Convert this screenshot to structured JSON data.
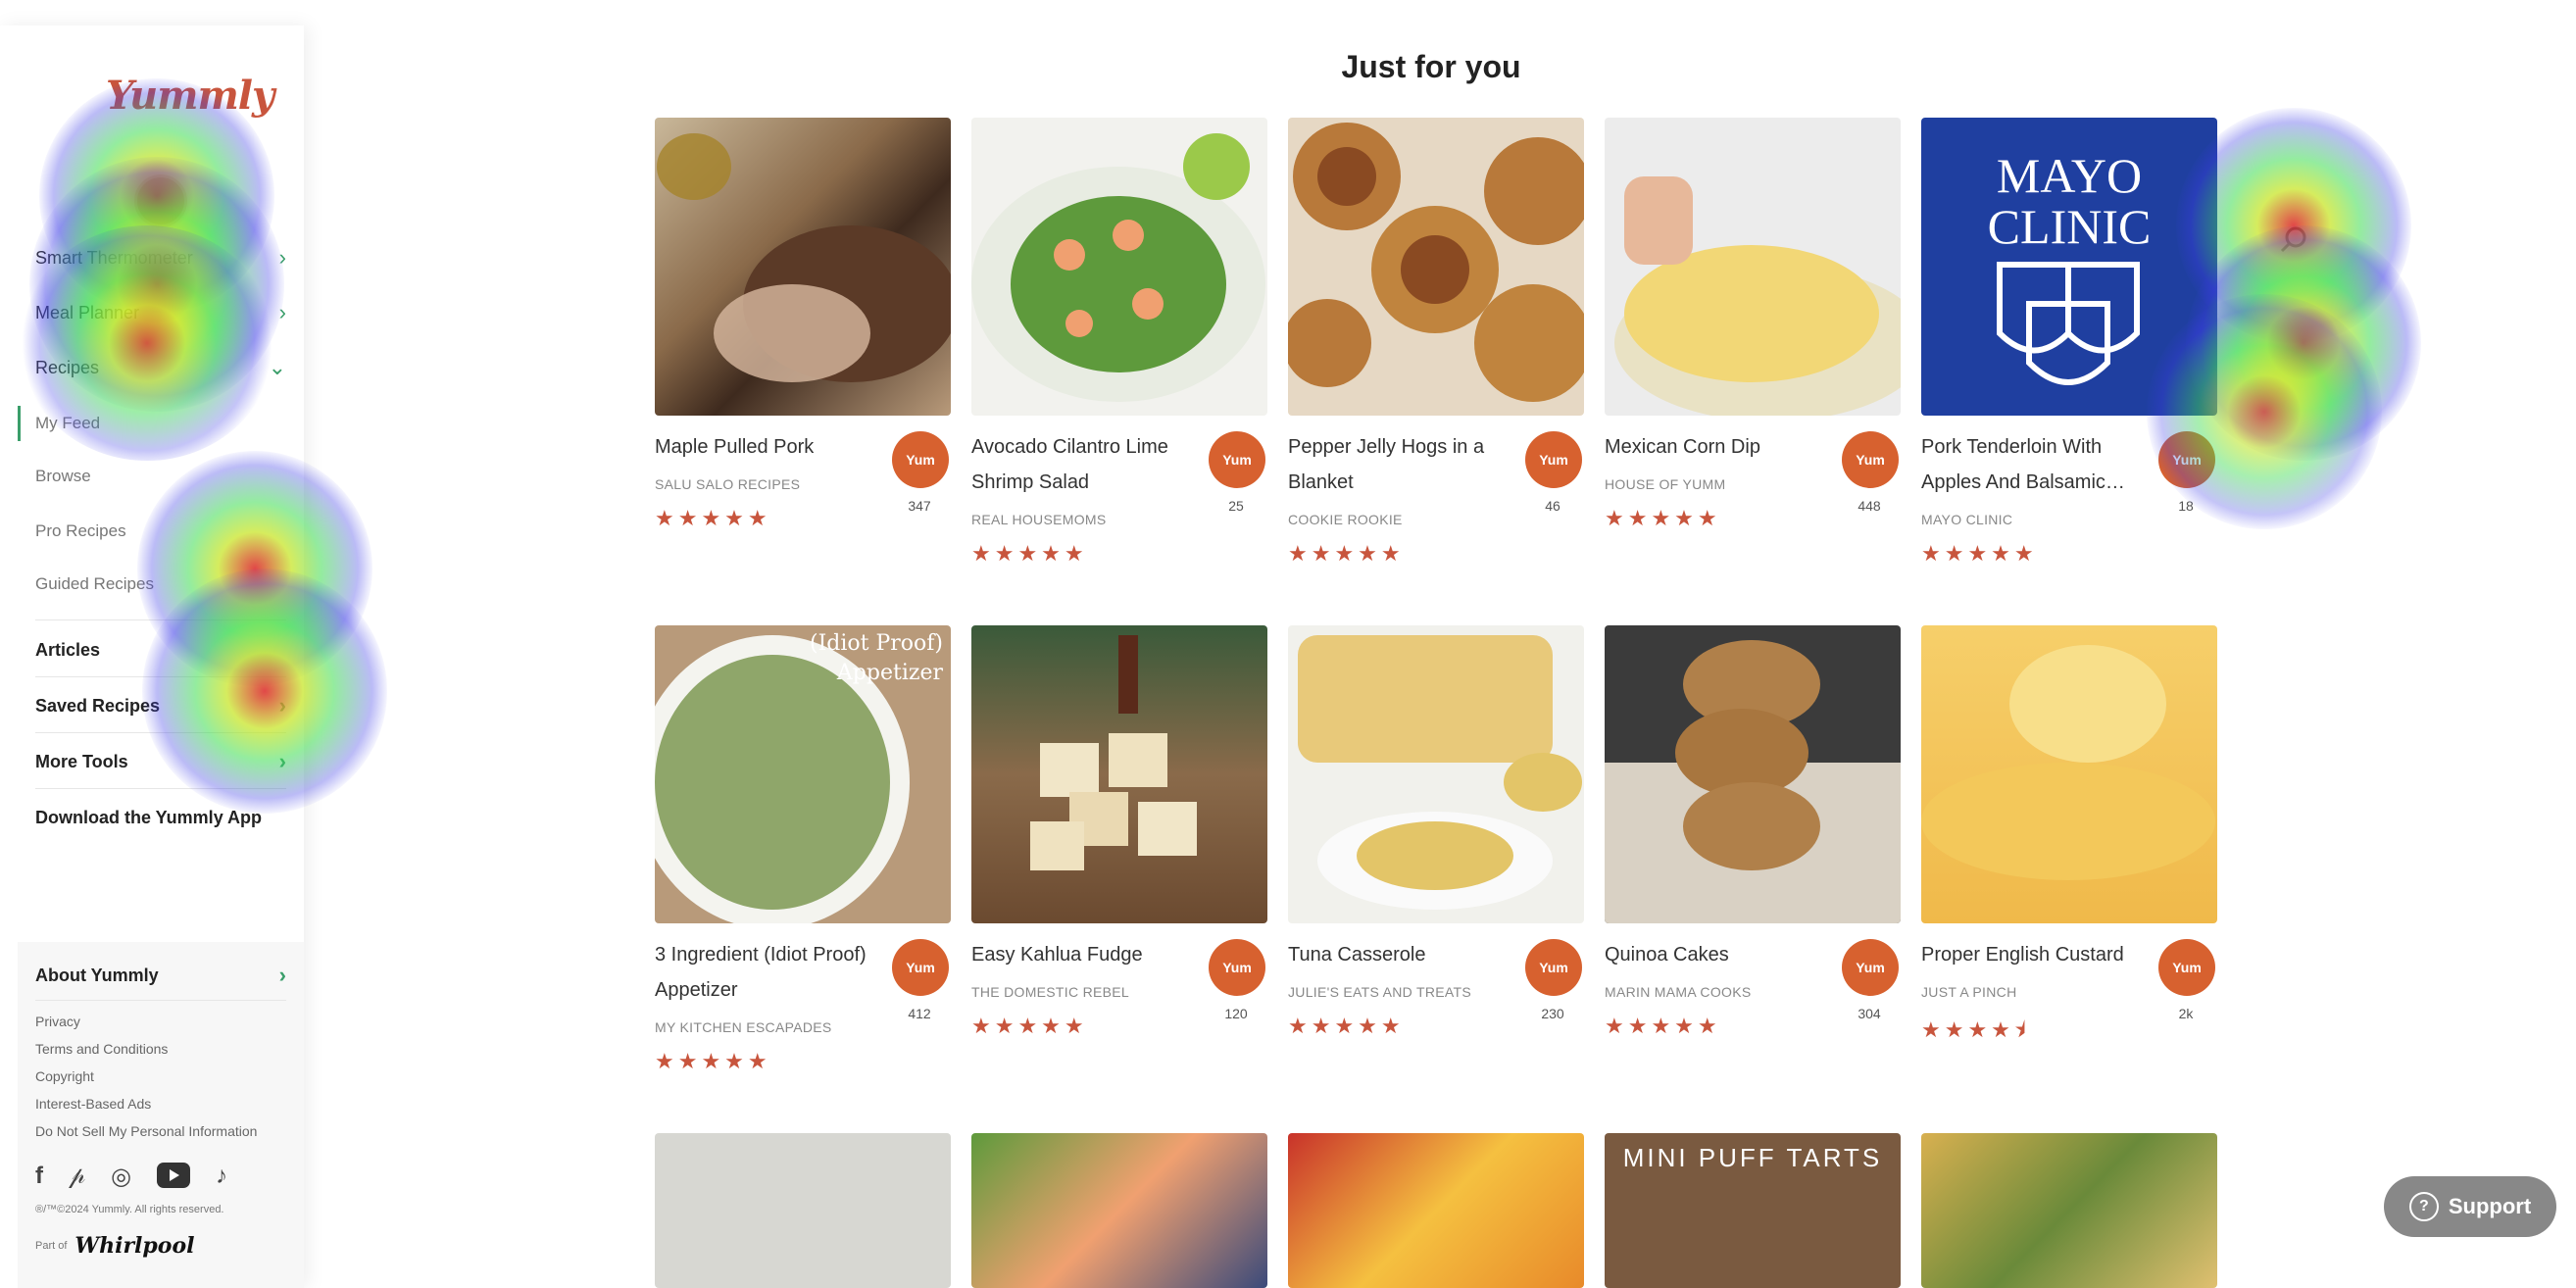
{
  "sidebar": {
    "logo": "Yummly",
    "nav": [
      {
        "label": "Smart Thermometer",
        "chevron": "›"
      },
      {
        "label": "Meal Planner",
        "chevron": "›"
      },
      {
        "label": "Recipes",
        "chevron": "⌄"
      }
    ],
    "sub_items": [
      "My Feed",
      "Browse",
      "Pro Recipes",
      "Guided Recipes"
    ],
    "sections": [
      {
        "label": "Articles",
        "chevron": ""
      },
      {
        "label": "Saved Recipes",
        "chevron": "›"
      },
      {
        "label": "More Tools",
        "chevron": "›"
      },
      {
        "label": "Download the Yummly App",
        "chevron": ""
      }
    ],
    "about": {
      "label": "About Yummly",
      "chevron": "›"
    },
    "legal": [
      "Privacy",
      "Terms and Conditions",
      "Copyright",
      "Interest-Based Ads",
      "Do Not Sell My Personal Information"
    ],
    "social_icons": [
      "facebook-icon",
      "pinterest-icon",
      "instagram-icon",
      "youtube-icon",
      "tiktok-icon"
    ],
    "copyright": "®/™©2024 Yummly. All rights reserved.",
    "part_of": "Part of",
    "part_of_brand": "Whirlpool"
  },
  "main": {
    "title": "Just for you",
    "yum_label": "Yum",
    "cards": [
      {
        "title": "Maple Pulled Pork",
        "source": "SALU SALO RECIPES",
        "count": "347",
        "rating": 5,
        "stars": "★★★★★"
      },
      {
        "title": "Avocado Cilantro Lime Shrimp Salad",
        "source": "REAL HOUSEMOMS",
        "count": "25",
        "rating": 5,
        "stars": "★★★★★"
      },
      {
        "title": "Pepper Jelly Hogs in a Blanket",
        "source": "COOKIE ROOKIE",
        "count": "46",
        "rating": 5,
        "stars": "★★★★★"
      },
      {
        "title": "Mexican Corn Dip",
        "source": "HOUSE OF YUMM",
        "count": "448",
        "rating": 5,
        "stars": "★★★★★"
      },
      {
        "title": "Pork Tenderloin With Apples And Balsamic…",
        "source": "MAYO CLINIC",
        "count": "18",
        "rating": 5,
        "stars": "★★★★★",
        "image_text": [
          "MAYO",
          "CLINIC"
        ]
      },
      {
        "title": "3 Ingredient (Idiot Proof) Appetizer",
        "source": "MY KITCHEN ESCAPADES",
        "count": "412",
        "rating": 5,
        "stars": "★★★★★",
        "image_text": [
          "(Idiot Proof)",
          "Appetizer"
        ]
      },
      {
        "title": "Easy Kahlua Fudge",
        "source": "THE DOMESTIC REBEL",
        "count": "120",
        "rating": 5,
        "stars": "★★★★★"
      },
      {
        "title": "Tuna Casserole",
        "source": "JULIE'S EATS AND TREATS",
        "count": "230",
        "rating": 5,
        "stars": "★★★★★"
      },
      {
        "title": "Quinoa Cakes",
        "source": "MARIN MAMA COOKS",
        "count": "304",
        "rating": 5,
        "stars": "★★★★★"
      },
      {
        "title": "Proper English Custard",
        "source": "JUST A PINCH",
        "count": "2k",
        "rating": 4.5,
        "stars": "★★★★⯨"
      }
    ],
    "row3_image_text": "MINI PUFF TARTS"
  },
  "search_icon": "search-icon",
  "support": {
    "label": "Support"
  },
  "colors": {
    "accent": "#d7612f",
    "green": "#3a9e6a",
    "mayo_blue": "#1f3fa0"
  }
}
